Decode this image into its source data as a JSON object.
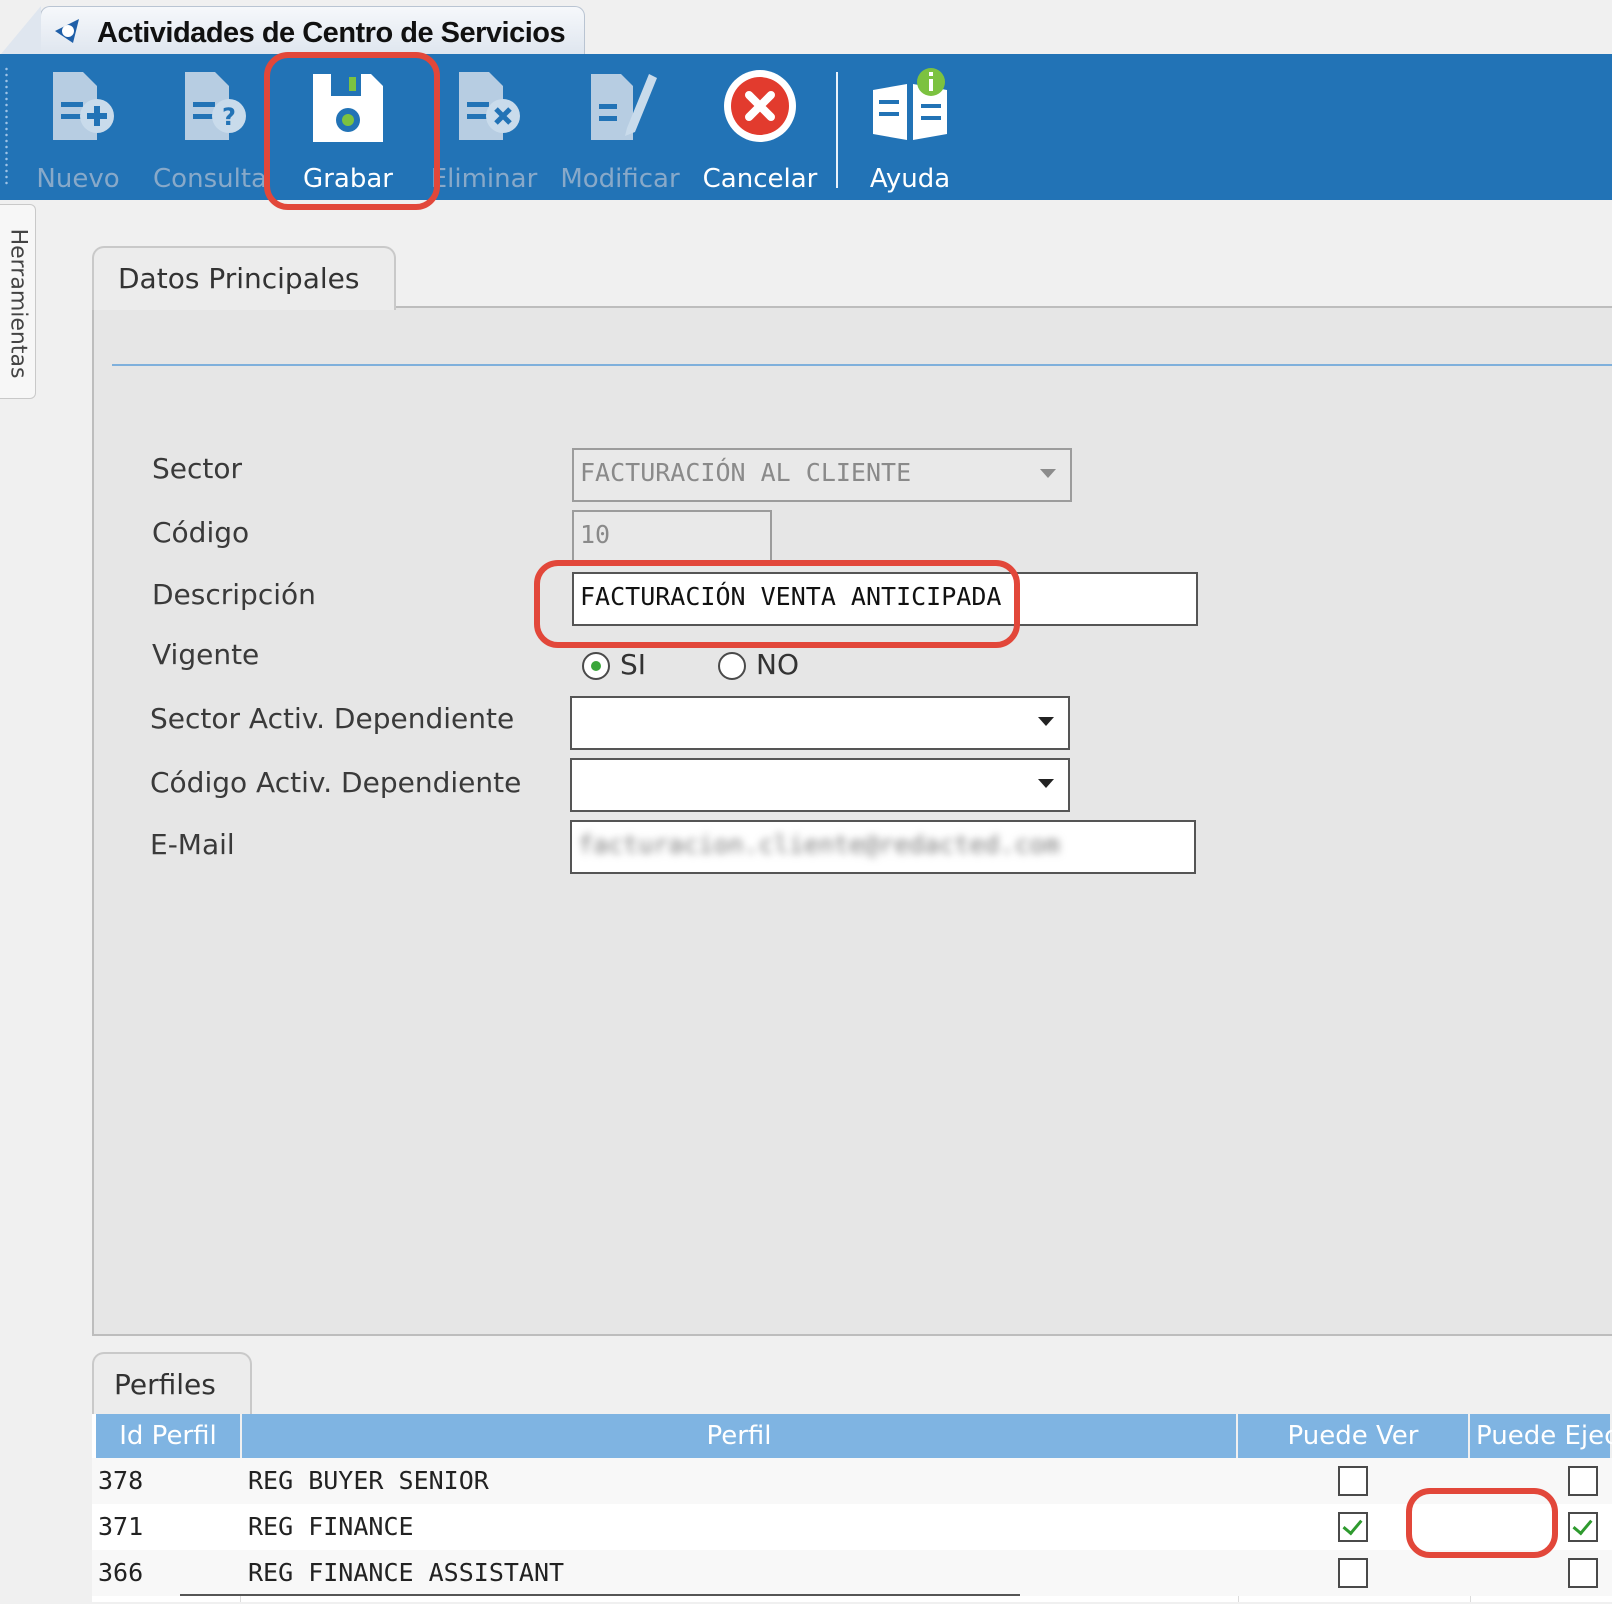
{
  "window": {
    "title": "Actividades de Centro de Servicios"
  },
  "toolbar": {
    "buttons": [
      {
        "label": "Nuevo",
        "enabled": false,
        "icon": "document-add-icon"
      },
      {
        "label": "Consulta",
        "enabled": false,
        "icon": "document-query-icon"
      },
      {
        "label": "Grabar",
        "enabled": true,
        "icon": "save-floppy-icon"
      },
      {
        "label": "Eliminar",
        "enabled": false,
        "icon": "document-delete-icon"
      },
      {
        "label": "Modificar",
        "enabled": false,
        "icon": "document-edit-icon"
      },
      {
        "label": "Cancelar",
        "enabled": true,
        "icon": "cancel-icon"
      },
      {
        "label": "Ayuda",
        "enabled": true,
        "icon": "help-book-icon"
      }
    ]
  },
  "side_panel": {
    "label": "Herramientas"
  },
  "form": {
    "tab_label": "Datos Principales",
    "sector": {
      "label": "Sector",
      "value": "FACTURACIÓN AL CLIENTE"
    },
    "codigo": {
      "label": "Código",
      "value": "10"
    },
    "descripcion": {
      "label": "Descripción",
      "value": "FACTURACIÓN VENTA ANTICIPADA"
    },
    "vigente": {
      "label": "Vigente",
      "options": [
        "SI",
        "NO"
      ],
      "selected": "SI"
    },
    "sector_dependiente": {
      "label": "Sector Activ. Dependiente",
      "value": ""
    },
    "codigo_dependiente": {
      "label": "Código Activ. Dependiente",
      "value": ""
    },
    "email": {
      "label": "E-Mail",
      "value": "facturacion.cliente@redacted.com"
    }
  },
  "profiles": {
    "tab_label": "Perfiles",
    "columns": [
      "Id Perfil",
      "Perfil",
      "Puede Ver",
      "Puede Ejecutar"
    ],
    "rows": [
      {
        "id": "378",
        "perfil": "REG BUYER SENIOR",
        "puede_ver": false,
        "puede_ejecutar": false
      },
      {
        "id": "371",
        "perfil": "REG FINANCE",
        "puede_ver": true,
        "puede_ejecutar": true
      },
      {
        "id": "366",
        "perfil": "REG FINANCE ASSISTANT",
        "puede_ver": false,
        "puede_ejecutar": false
      }
    ]
  },
  "colors": {
    "toolbar": "#2273b6",
    "grid_header": "#7fb4e2",
    "highlight": "#e2473a"
  }
}
